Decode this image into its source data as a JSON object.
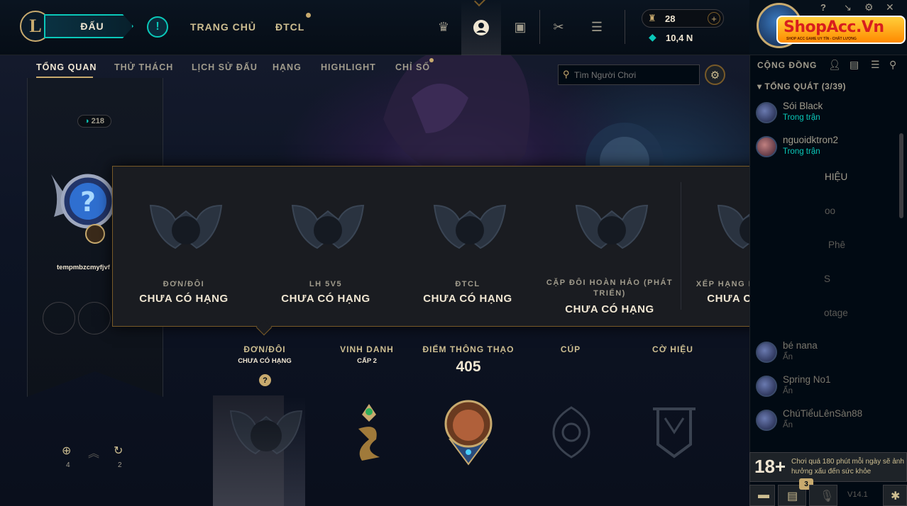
{
  "topnav": {
    "play": "ĐẤU",
    "home": "TRANG CHỦ",
    "tft": "ĐTCL"
  },
  "currency": {
    "rp": "28",
    "be": "10,4 N"
  },
  "watermark": {
    "title": "ShopAcc.Vn",
    "subtitle": "SHOP ACC GAME UY TÍN - CHẤT LƯỢNG"
  },
  "window_controls": [
    "?",
    "↘",
    "⚙",
    "✕"
  ],
  "tabs": [
    "TỔNG QUAN",
    "THỬ THÁCH",
    "LỊCH SỬ ĐẤU",
    "HẠNG",
    "HIGHLIGHT",
    "CHỈ SỐ"
  ],
  "search": {
    "placeholder": "Tìm Người Chơi"
  },
  "profile": {
    "level": "218",
    "name": "tempmbzcmyfjvf",
    "stats": [
      {
        "value": "4"
      },
      {
        "value": "2"
      }
    ]
  },
  "ranks_popup": [
    {
      "queue": "ĐƠN/ĐÔI",
      "tier": "CHƯA CÓ HẠNG"
    },
    {
      "queue": "LH 5V5",
      "tier": "CHƯA CÓ HẠNG"
    },
    {
      "queue": "ĐTCL",
      "tier": "CHƯA CÓ HẠNG"
    },
    {
      "queue": "CẶP ĐÔI HOÀN HẢO (PHÁT TRIỂN)",
      "tier": "CHƯA CÓ HẠNG"
    },
    {
      "queue": "XẾP HẠNG MÙA TRƯỚC",
      "tier": "CHƯA CÓ HẠNG"
    }
  ],
  "overview": {
    "ranked_title": "ĐƠN/ĐÔI",
    "ranked_sub": "CHƯA CÓ HẠNG",
    "help": "?",
    "honor_title": "VINH DANH",
    "honor_sub": "CẤP 2",
    "mastery_title": "ĐIỂM THÔNG THẠO",
    "mastery_value": "405",
    "trophy_title": "CÚP",
    "banner_title": "CỜ HIỆU"
  },
  "social": {
    "header": "CỘNG ĐỒNG",
    "group": "TỔNG QUÁT (3/39)",
    "friends": [
      {
        "name": "Sói Black",
        "status": "Trong trận"
      },
      {
        "name": "nguoidktron2",
        "status": "Trong trận"
      }
    ],
    "partial": [
      "HIỆU",
      "oo",
      "Phê",
      "S",
      "otage"
    ],
    "offline": [
      {
        "name": "bé nana",
        "status": "Ẩn"
      },
      {
        "name": "Spring No1",
        "status": "Ẩn"
      },
      {
        "name": "ChúTiểuLênSàn88",
        "status": "Ẩn"
      }
    ]
  },
  "age_notice": {
    "rating": "18+",
    "text": "Chơi quá 180 phút mỗi ngày sẽ ảnh hưởng xấu đến sức khỏe"
  },
  "footer": {
    "badge": "3",
    "version": "V14.1"
  }
}
